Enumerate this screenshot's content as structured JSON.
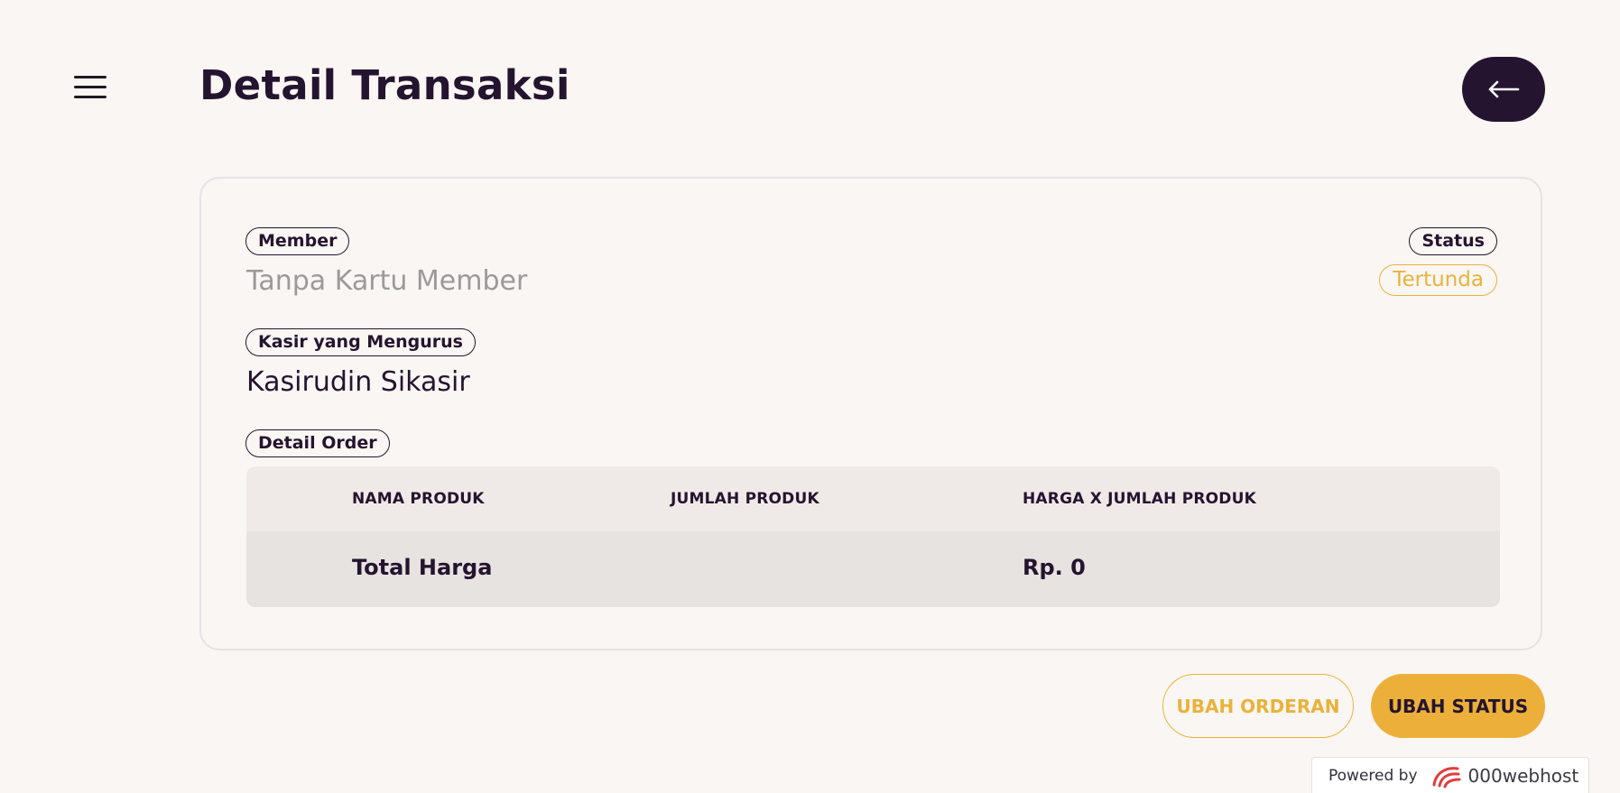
{
  "header": {
    "menu_icon": "hamburger-menu-icon",
    "title": "Detail Transaksi",
    "back_icon": "arrow-left-icon"
  },
  "detail": {
    "member_label": "Member",
    "member_value": "Tanpa Kartu Member",
    "status_label": "Status",
    "status_value": "Tertunda",
    "cashier_label": "Kasir yang Mengurus",
    "cashier_value": "Kasirudin Sikasir",
    "order_label": "Detail Order"
  },
  "table": {
    "columns": [
      "NAMA PRODUK",
      "JUMLAH PRODUK",
      "HARGA X JUMLAH PRODUK"
    ],
    "total_label": "Total Harga",
    "total_value": "Rp. 0"
  },
  "actions": {
    "edit_order_label": "UBAH ORDERAN",
    "edit_status_label": "UBAH STATUS"
  },
  "footer": {
    "powered_by": "Powered by",
    "brand": "000webhost",
    "brand_icon": "000webhost-logo-icon"
  },
  "colors": {
    "primary_dark": "#25142f",
    "accent": "#ecb03a",
    "background": "#faf6f3",
    "muted_text": "#9a9a9a"
  }
}
